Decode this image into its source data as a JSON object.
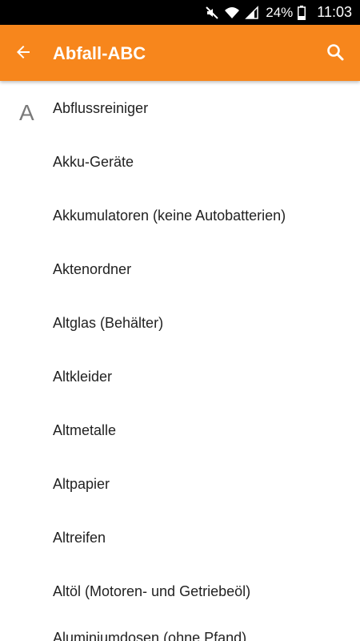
{
  "status_bar": {
    "battery": "24%",
    "time": "11:03"
  },
  "app_bar": {
    "title": "Abfall-ABC"
  },
  "section": {
    "letter": "A"
  },
  "items": [
    "Abflussreiniger",
    "Akku-Geräte",
    "Akkumulatoren (keine Autobatterien)",
    "Aktenordner",
    "Altglas (Behälter)",
    "Altkleider",
    "Altmetalle",
    "Altpapier",
    "Altreifen",
    "Altöl (Motoren- und Getriebeöl)",
    "Aluminiumdosen (ohne Pfand)"
  ],
  "colors": {
    "accent": "#f7861c"
  }
}
